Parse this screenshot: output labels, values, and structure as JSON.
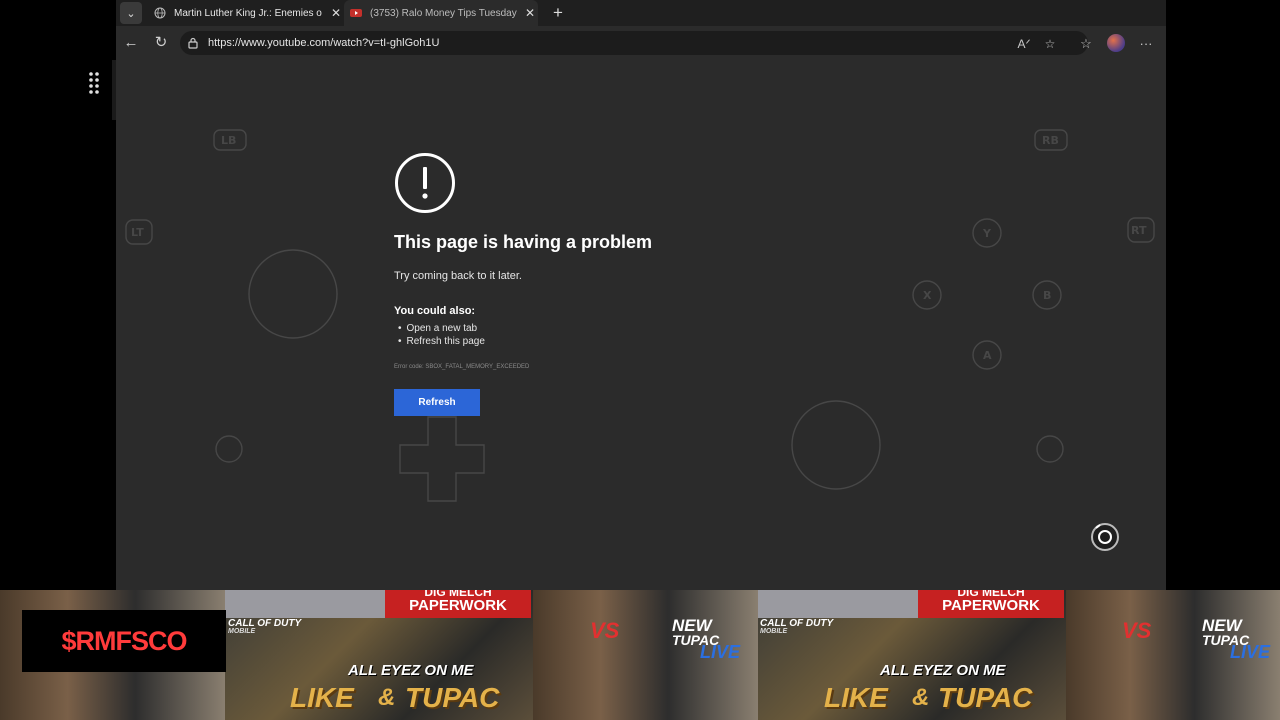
{
  "tabs": [
    {
      "title": "Martin Luther King Jr.: Enemies o",
      "active": false
    },
    {
      "title": "(3753) Ralo Money Tips Tuesday",
      "active": true
    }
  ],
  "address_bar": {
    "url": "https://www.youtube.com/watch?v=tI-ghlGoh1U"
  },
  "error_page": {
    "title": "This page is having a problem",
    "subtitle": "Try coming back to it later.",
    "could_also_heading": "You could also:",
    "suggestions": [
      "Open a new tab",
      "Refresh this page"
    ],
    "error_code": "Error code: SBOX_FATAL_MEMORY_EXCEEDED",
    "refresh_label": "Refresh"
  },
  "controller_overlay": {
    "labels": [
      "LB",
      "RB",
      "LT",
      "RT",
      "Y",
      "X",
      "B",
      "A"
    ]
  },
  "banner": {
    "brand": "$RMFSCO",
    "paperwork_top": "DIG MELCH",
    "paperwork": "PAPERWORK",
    "call_of_duty": "CALL OF DUTY",
    "call_of_duty_sub": "MOBILE",
    "all_eyez": "ALL EYEZ ON ME",
    "like": "LIKE",
    "amp": "&",
    "tupac": "TUPAC",
    "new": "NEW",
    "tupac2": "TUPAC",
    "live": "LIVE",
    "vs": "VS"
  },
  "colors": {
    "page_bg": "#2b2b2b",
    "tabstrip_bg": "#1f1f1f",
    "refresh_button": "#2c66d7",
    "brand_red": "#ff3b3b"
  }
}
